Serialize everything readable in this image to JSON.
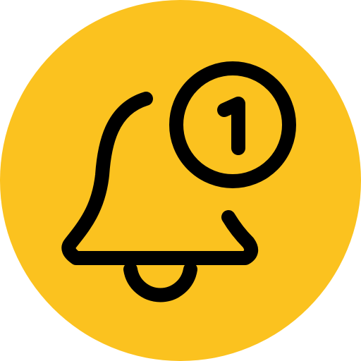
{
  "icon": {
    "name": "notification-bell-icon",
    "background_color": "#FBC21F",
    "stroke_color": "#000000"
  },
  "badge": {
    "count": "1"
  }
}
